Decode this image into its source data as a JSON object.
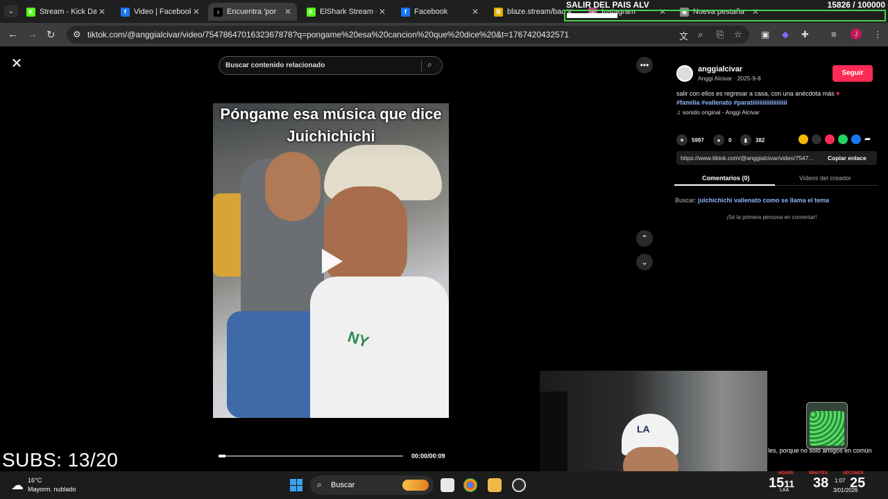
{
  "browser": {
    "tabs": [
      {
        "title": "Stream - Kick Dash",
        "favicon": "K",
        "favicon_color": "#53fc18",
        "active": false
      },
      {
        "title": "Video | Facebook",
        "favicon": "f",
        "favicon_color": "#1877f2",
        "active": false
      },
      {
        "title": "Encuentra 'por",
        "favicon": "♪",
        "favicon_color": "#000000",
        "active": true
      },
      {
        "title": "ElShark Stream - V",
        "favicon": "K",
        "favicon_color": "#53fc18",
        "active": false
      },
      {
        "title": "Facebook",
        "favicon": "f",
        "favicon_color": "#1877f2",
        "active": false
      },
      {
        "title": "blaze.stream/back",
        "favicon": "B",
        "favicon_color": "#e0b000",
        "active": false
      },
      {
        "title": "Instagram",
        "favicon": "◎",
        "favicon_color": "#c13584",
        "active": false
      },
      {
        "title": "Nueva pestaña",
        "favicon": "◉",
        "favicon_color": "#888888",
        "active": false
      }
    ],
    "url": "tiktok.com/@anggialcivar/video/7547864701632367878?q=pongame%20esa%20cancion%20que%20dice%20&t=1767420432571"
  },
  "stream_overlay": {
    "goal_title": "SALIR DEL PAIS ALV",
    "goal_count": "15826 / 100000",
    "goal_progress": 0.158,
    "subs": "SUBS: 13/20",
    "marquee": "les, porque no solo amigos en común",
    "timer": {
      "hours": "15",
      "minutes": "38",
      "seconds": "25",
      "hours_label": "HOURS",
      "minutes_label": "MINUTES",
      "seconds_label": "SECONDS"
    },
    "timer_hours_prefix": "15",
    "timer_hours_suffix": "11"
  },
  "tiktok": {
    "search_placeholder": "Buscar contenido relacionado",
    "video_caption": "Póngame esa música que dice Juichichichi",
    "video_time": "00:00/00:09",
    "video_progress": 0.0,
    "author": {
      "username": "anggialcivar",
      "subline": "Anggi Alcivar · 2025-9-8",
      "follow_label": "Seguir"
    },
    "description": "salir con ellos es regresar a casa, con una anécdota más",
    "hashtags": "#familia #vallenato #paratiiiiiiiiiiiiiiiiiiii",
    "sound": "sonido original - Anggi Alcivar",
    "stats": {
      "likes": "5997",
      "comments": "0",
      "saves": "382"
    },
    "share_link": "https://www.tiktok.com/@anggialcivar/video/7547...",
    "copy_label": "Copiar enlace",
    "tab_comments": "Comentarios (0)",
    "tab_videos": "Videos del creador",
    "search_prefix": "Buscar:",
    "search_query": "juichichichi vallenato como se llama el tema",
    "no_comments": "¡Sé la primera persona en comentar!"
  },
  "taskbar": {
    "weather_temp": "16°C",
    "weather_desc": "Mayorm. nublado",
    "search_label": "Buscar",
    "clock_time": "1:07",
    "clock_date": "3/01/2026",
    "lang": "LAA"
  },
  "colors": {
    "accent_follow": "#fe2c55",
    "hashtag": "#8fb6ff",
    "goal_border": "#46d34a"
  }
}
